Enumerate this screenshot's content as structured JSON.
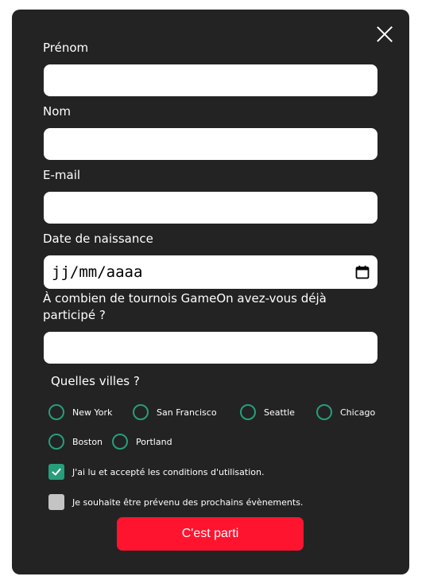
{
  "form": {
    "fields": {
      "first_name": {
        "label": "Prénom",
        "value": ""
      },
      "last_name": {
        "label": "Nom",
        "value": ""
      },
      "email": {
        "label": "E-mail",
        "value": ""
      },
      "birthdate": {
        "label": "Date de naissance",
        "placeholder": "jj/mm/aaaa"
      },
      "tournaments": {
        "label_line1": "À combien de tournois GameOn avez-vous déjà",
        "label_line2": "participé ?",
        "value": ""
      }
    },
    "cities": {
      "title": "Quelles villes ?",
      "options": [
        "New York",
        "San Francisco",
        "Seattle",
        "Chicago",
        "Boston",
        "Portland"
      ]
    },
    "checkboxes": {
      "terms": {
        "label": "J'ai lu et accepté les conditions d'utilisation.",
        "checked": true
      },
      "newsletter": {
        "label": "Je souhaite être prévenu des prochains évènements.",
        "checked": false
      }
    },
    "submit_label": "C'est parti"
  },
  "colors": {
    "modal_bg": "#232323",
    "accent_green": "#279e7a",
    "submit_red": "#fe142f"
  },
  "icons": {
    "close": "close-icon",
    "calendar": "calendar-icon",
    "check": "checkmark-icon"
  }
}
